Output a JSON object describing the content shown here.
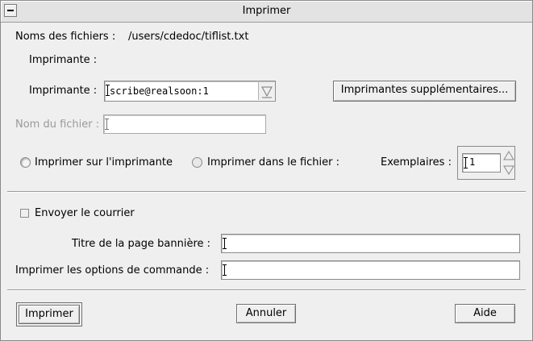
{
  "window": {
    "title": "Imprimer"
  },
  "file": {
    "label": "Noms des fichiers :",
    "value": "/users/cdedoc/tiflist.txt"
  },
  "printer_section": {
    "label": "Imprimante :"
  },
  "printer": {
    "label": "Imprimante :",
    "value": "scribe@realsoon:1",
    "more_button": "Imprimantes supplémentaires..."
  },
  "filename": {
    "label": "Nom du fichier :",
    "value": ""
  },
  "destination": {
    "to_printer": "Imprimer sur l'imprimante",
    "to_file": "Imprimer dans le fichier :",
    "selected": "to_printer"
  },
  "copies": {
    "label": "Exemplaires :",
    "value": "1"
  },
  "mail": {
    "label": "Envoyer le courrier",
    "checked": false
  },
  "banner": {
    "label": "Titre de la page bannière :",
    "value": ""
  },
  "options": {
    "label": "Imprimer les options de commande :",
    "value": ""
  },
  "buttons": {
    "print": "Imprimer",
    "cancel": "Annuler",
    "help": "Aide"
  }
}
